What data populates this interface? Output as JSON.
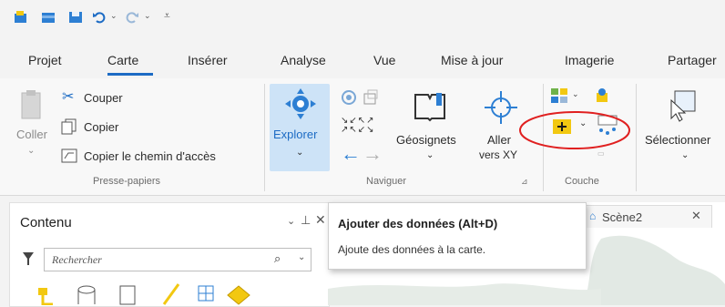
{
  "tabs": [
    "Projet",
    "Carte",
    "Insérer",
    "Analyse",
    "Vue",
    "Mise à jour",
    "Imagerie",
    "Partager"
  ],
  "ribbon": {
    "clipboard": {
      "paste": "Coller",
      "cut": "Couper",
      "copy": "Copier",
      "copy_path": "Copier le chemin d'accès",
      "group": "Presse-papiers"
    },
    "navigate": {
      "explore": "Explorer",
      "bookmarks": "Géosignets",
      "goto_line1": "Aller",
      "goto_line2": "vers XY",
      "group": "Naviguer"
    },
    "layer": {
      "group": "Couche"
    },
    "selection": {
      "select": "Sélectionner"
    }
  },
  "contents": {
    "title": "Contenu",
    "search_placeholder": "Rechercher"
  },
  "tooltip": {
    "title": "Ajouter des données (Alt+D)",
    "description": "Ajoute des données à la carte."
  },
  "map_tab": {
    "label": "Scène2"
  },
  "colors": {
    "accent": "#1c6bc4",
    "highlight": "#cde3f7",
    "annotation_circle": "#e02020",
    "add_data_yellow": "#f2c811"
  }
}
